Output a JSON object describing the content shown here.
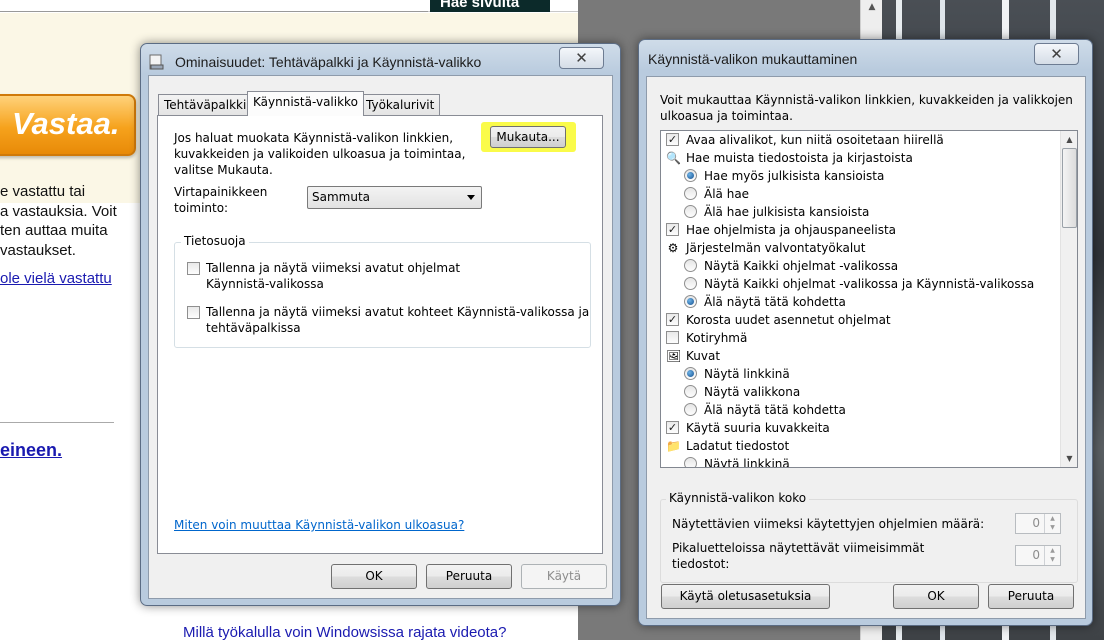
{
  "background": {
    "search_button_label": "Hae sivulta",
    "answer_button_label": "Vastaa.",
    "text_lines": [
      "e vastattu tai",
      "a vastauksia. Voit",
      "ten auttaa muita",
      " vastaukset."
    ],
    "link_text": "ole vielä vastattu",
    "bold_link_text": "eineen.",
    "bottom_link_text": "Millä työkalulla voin Windowsissa rajata videota?"
  },
  "left_dialog": {
    "title": "Ominaisuudet: Tehtäväpalkki ja Käynnistä-valikko",
    "close_glyph": "✕",
    "tabs": [
      {
        "label": "Tehtäväpalkki",
        "active": false
      },
      {
        "label": "Käynnistä-valikko",
        "active": true
      },
      {
        "label": "Työkalurivit",
        "active": false
      }
    ],
    "description_lines": [
      "Jos haluat muokata Käynnistä-valikon linkkien,",
      "kuvakkeiden ja valikoiden ulkoasua ja toimintaa,",
      "valitse Mukauta."
    ],
    "customize_button": "Mukauta...",
    "power_label_lines": [
      "Virtapainikkeen",
      "toiminto:"
    ],
    "power_value": "Sammuta",
    "privacy_group_title": "Tietosuoja",
    "privacy_options": [
      {
        "lines": [
          "Tallenna ja näytä viimeksi avatut ohjelmat",
          "Käynnistä-valikossa"
        ],
        "checked": false
      },
      {
        "lines": [
          "Tallenna ja näytä viimeksi avatut kohteet Käynnistä-valikossa ja",
          "tehtäväpalkissa"
        ],
        "checked": false
      }
    ],
    "help_link": "Miten voin muuttaa Käynnistä-valikon ulkoasua?",
    "buttons": {
      "ok": "OK",
      "cancel": "Peruuta",
      "apply": "Käytä"
    }
  },
  "right_dialog": {
    "title": "Käynnistä-valikon mukauttaminen",
    "close_glyph": "✕",
    "description_lines": [
      "Voit mukauttaa Käynnistä-valikon linkkien, kuvakkeiden ja valikkojen",
      "ulkoasua ja toimintaa."
    ],
    "tree_items": [
      {
        "label": "Avaa alivalikot, kun niitä osoitetaan hiirellä",
        "kind": "checkbox",
        "checked": true,
        "level": 0
      },
      {
        "label": "Hae muista tiedostoista ja kirjastoista",
        "kind": "icon",
        "icon": "search-folder-icon",
        "level": 0
      },
      {
        "label": "Hae myös julkisista kansioista",
        "kind": "radio",
        "checked": true,
        "level": 1
      },
      {
        "label": "Älä hae",
        "kind": "radio",
        "checked": false,
        "level": 1
      },
      {
        "label": "Älä hae julkisista kansioista",
        "kind": "radio",
        "checked": false,
        "level": 1
      },
      {
        "label": "Hae ohjelmista ja ohjauspaneelista",
        "kind": "checkbox",
        "checked": true,
        "level": 0
      },
      {
        "label": "Järjestelmän valvontatyökalut",
        "kind": "icon",
        "icon": "admin-tools-icon",
        "level": 0
      },
      {
        "label": "Näytä Kaikki ohjelmat -valikossa",
        "kind": "radio",
        "checked": false,
        "level": 1
      },
      {
        "label": "Näytä Kaikki ohjelmat -valikossa ja Käynnistä-valikossa",
        "kind": "radio",
        "checked": false,
        "level": 1
      },
      {
        "label": "Älä näytä tätä kohdetta",
        "kind": "radio",
        "checked": true,
        "level": 1
      },
      {
        "label": "Korosta uudet asennetut ohjelmat",
        "kind": "checkbox",
        "checked": true,
        "level": 0
      },
      {
        "label": "Kotiryhmä",
        "kind": "checkbox",
        "checked": false,
        "level": 0
      },
      {
        "label": "Kuvat",
        "kind": "icon",
        "icon": "pictures-icon",
        "level": 0
      },
      {
        "label": "Näytä linkkinä",
        "kind": "radio",
        "checked": true,
        "level": 1
      },
      {
        "label": "Näytä valikkona",
        "kind": "radio",
        "checked": false,
        "level": 1
      },
      {
        "label": "Älä näytä tätä kohdetta",
        "kind": "radio",
        "checked": false,
        "level": 1
      },
      {
        "label": "Käytä suuria kuvakkeita",
        "kind": "checkbox",
        "checked": true,
        "level": 0
      },
      {
        "label": "Ladatut tiedostot",
        "kind": "icon",
        "icon": "downloads-folder-icon",
        "level": 0
      },
      {
        "label": "Näytä linkkinä",
        "kind": "radio",
        "checked": false,
        "level": 1
      }
    ],
    "size_group_title": "Käynnistä-valikon koko",
    "recent_programs_label": "Näytettävien viimeksi käytettyjen ohjelmien määrä:",
    "recent_programs_value": "0",
    "jumplist_label_lines": [
      "Pikaluetteloissa näytettävät viimeisimmät",
      "tiedostot:"
    ],
    "jumplist_value": "0",
    "buttons": {
      "defaults": "Käytä oletusasetuksia",
      "ok": "OK",
      "cancel": "Peruuta"
    }
  }
}
